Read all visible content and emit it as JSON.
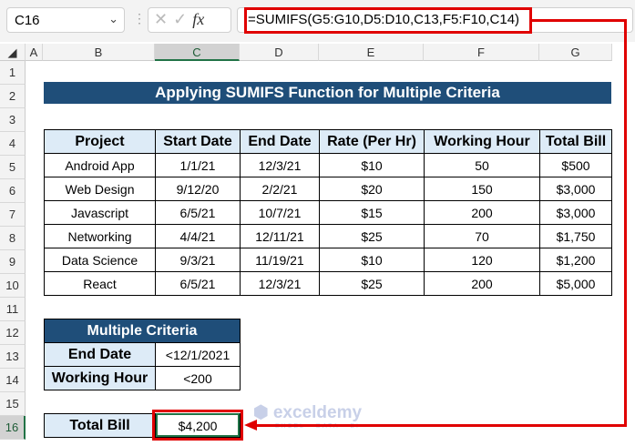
{
  "name_box": "C16",
  "formula": "=SUMIFS(G5:G10,D5:D10,C13,F5:F10,C14)",
  "columns": [
    "A",
    "B",
    "C",
    "D",
    "E",
    "F",
    "G"
  ],
  "rows": [
    "1",
    "2",
    "3",
    "4",
    "5",
    "6",
    "7",
    "8",
    "9",
    "10",
    "11",
    "12",
    "13",
    "14",
    "15",
    "16"
  ],
  "title": "Applying SUMIFS Function for Multiple Criteria",
  "headers": [
    "Project",
    "Start Date",
    "End Date",
    "Rate (Per Hr)",
    "Working Hour",
    "Total Bill"
  ],
  "data": [
    [
      "Android App",
      "1/1/21",
      "12/3/21",
      "$10",
      "50",
      "$500"
    ],
    [
      "Web Design",
      "9/12/20",
      "2/2/21",
      "$20",
      "150",
      "$3,000"
    ],
    [
      "Javascript",
      "6/5/21",
      "10/7/21",
      "$15",
      "200",
      "$3,000"
    ],
    [
      "Networking",
      "4/4/21",
      "12/11/21",
      "$25",
      "70",
      "$1,750"
    ],
    [
      "Data Science",
      "9/3/21",
      "11/19/21",
      "$10",
      "120",
      "$1,200"
    ],
    [
      "React",
      "6/5/21",
      "12/3/21",
      "$25",
      "200",
      "$5,000"
    ]
  ],
  "criteria": {
    "title": "Multiple Criteria",
    "items": [
      {
        "label": "End Date",
        "value": "<12/1/2021"
      },
      {
        "label": "Working Hour",
        "value": "<200"
      }
    ]
  },
  "total": {
    "label": "Total Bill",
    "value": "$4,200"
  },
  "watermark": {
    "name": "exceldemy",
    "tagline": "EXCEL · DATA · BI"
  }
}
